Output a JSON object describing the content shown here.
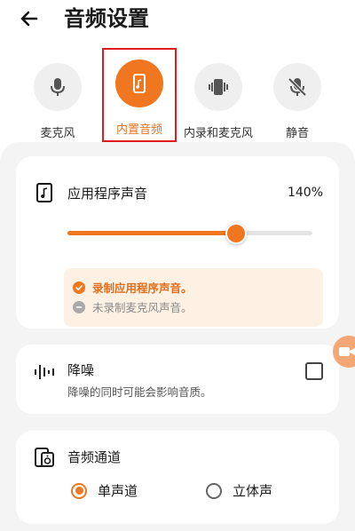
{
  "header": {
    "title": "音频设置",
    "back_icon": "arrow-left-icon"
  },
  "modes": [
    {
      "label": "麦克风",
      "icon": "microphone-icon",
      "active": false
    },
    {
      "label": "内置音频",
      "icon": "music-phone-icon",
      "active": true
    },
    {
      "label": "内录和麦克风",
      "icon": "phone-audio-icon",
      "active": false
    },
    {
      "label": "静音",
      "icon": "mic-off-icon",
      "active": false
    }
  ],
  "app_sound": {
    "title": "应用程序声音",
    "percent_label": "140%",
    "slider_fraction": 0.69,
    "info_checked": "录制应用程序声音。",
    "info_unchecked": "未录制麦克风声音。"
  },
  "noise": {
    "title": "降噪",
    "subtitle": "降噪的同时可能会影响音质。",
    "checked": false
  },
  "channel": {
    "title": "音频通道",
    "options": [
      {
        "label": "单声道",
        "checked": true
      },
      {
        "label": "立体声",
        "checked": false
      }
    ]
  },
  "colors": {
    "accent": "#f07720",
    "highlight_border": "#e01b1b",
    "panel_bg": "#f4f4f4",
    "info_bg": "#fdf1e3"
  }
}
